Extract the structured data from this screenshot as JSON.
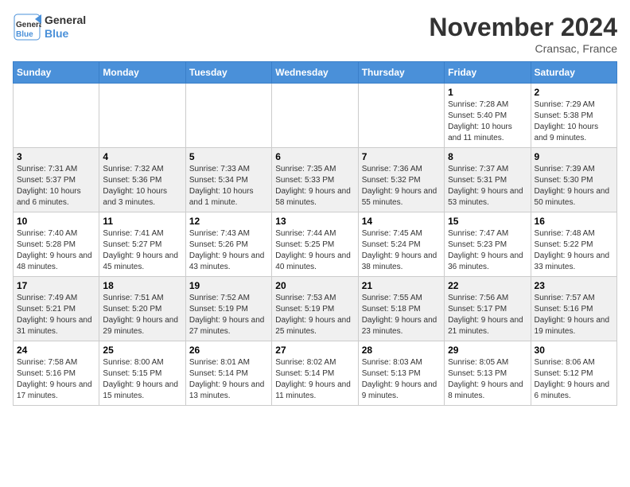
{
  "header": {
    "logo_line1": "General",
    "logo_line2": "Blue",
    "month_title": "November 2024",
    "location": "Cransac, France"
  },
  "days_of_week": [
    "Sunday",
    "Monday",
    "Tuesday",
    "Wednesday",
    "Thursday",
    "Friday",
    "Saturday"
  ],
  "weeks": [
    [
      {
        "day": "",
        "info": ""
      },
      {
        "day": "",
        "info": ""
      },
      {
        "day": "",
        "info": ""
      },
      {
        "day": "",
        "info": ""
      },
      {
        "day": "",
        "info": ""
      },
      {
        "day": "1",
        "info": "Sunrise: 7:28 AM\nSunset: 5:40 PM\nDaylight: 10 hours and 11 minutes."
      },
      {
        "day": "2",
        "info": "Sunrise: 7:29 AM\nSunset: 5:38 PM\nDaylight: 10 hours and 9 minutes."
      }
    ],
    [
      {
        "day": "3",
        "info": "Sunrise: 7:31 AM\nSunset: 5:37 PM\nDaylight: 10 hours and 6 minutes."
      },
      {
        "day": "4",
        "info": "Sunrise: 7:32 AM\nSunset: 5:36 PM\nDaylight: 10 hours and 3 minutes."
      },
      {
        "day": "5",
        "info": "Sunrise: 7:33 AM\nSunset: 5:34 PM\nDaylight: 10 hours and 1 minute."
      },
      {
        "day": "6",
        "info": "Sunrise: 7:35 AM\nSunset: 5:33 PM\nDaylight: 9 hours and 58 minutes."
      },
      {
        "day": "7",
        "info": "Sunrise: 7:36 AM\nSunset: 5:32 PM\nDaylight: 9 hours and 55 minutes."
      },
      {
        "day": "8",
        "info": "Sunrise: 7:37 AM\nSunset: 5:31 PM\nDaylight: 9 hours and 53 minutes."
      },
      {
        "day": "9",
        "info": "Sunrise: 7:39 AM\nSunset: 5:30 PM\nDaylight: 9 hours and 50 minutes."
      }
    ],
    [
      {
        "day": "10",
        "info": "Sunrise: 7:40 AM\nSunset: 5:28 PM\nDaylight: 9 hours and 48 minutes."
      },
      {
        "day": "11",
        "info": "Sunrise: 7:41 AM\nSunset: 5:27 PM\nDaylight: 9 hours and 45 minutes."
      },
      {
        "day": "12",
        "info": "Sunrise: 7:43 AM\nSunset: 5:26 PM\nDaylight: 9 hours and 43 minutes."
      },
      {
        "day": "13",
        "info": "Sunrise: 7:44 AM\nSunset: 5:25 PM\nDaylight: 9 hours and 40 minutes."
      },
      {
        "day": "14",
        "info": "Sunrise: 7:45 AM\nSunset: 5:24 PM\nDaylight: 9 hours and 38 minutes."
      },
      {
        "day": "15",
        "info": "Sunrise: 7:47 AM\nSunset: 5:23 PM\nDaylight: 9 hours and 36 minutes."
      },
      {
        "day": "16",
        "info": "Sunrise: 7:48 AM\nSunset: 5:22 PM\nDaylight: 9 hours and 33 minutes."
      }
    ],
    [
      {
        "day": "17",
        "info": "Sunrise: 7:49 AM\nSunset: 5:21 PM\nDaylight: 9 hours and 31 minutes."
      },
      {
        "day": "18",
        "info": "Sunrise: 7:51 AM\nSunset: 5:20 PM\nDaylight: 9 hours and 29 minutes."
      },
      {
        "day": "19",
        "info": "Sunrise: 7:52 AM\nSunset: 5:19 PM\nDaylight: 9 hours and 27 minutes."
      },
      {
        "day": "20",
        "info": "Sunrise: 7:53 AM\nSunset: 5:19 PM\nDaylight: 9 hours and 25 minutes."
      },
      {
        "day": "21",
        "info": "Sunrise: 7:55 AM\nSunset: 5:18 PM\nDaylight: 9 hours and 23 minutes."
      },
      {
        "day": "22",
        "info": "Sunrise: 7:56 AM\nSunset: 5:17 PM\nDaylight: 9 hours and 21 minutes."
      },
      {
        "day": "23",
        "info": "Sunrise: 7:57 AM\nSunset: 5:16 PM\nDaylight: 9 hours and 19 minutes."
      }
    ],
    [
      {
        "day": "24",
        "info": "Sunrise: 7:58 AM\nSunset: 5:16 PM\nDaylight: 9 hours and 17 minutes."
      },
      {
        "day": "25",
        "info": "Sunrise: 8:00 AM\nSunset: 5:15 PM\nDaylight: 9 hours and 15 minutes."
      },
      {
        "day": "26",
        "info": "Sunrise: 8:01 AM\nSunset: 5:14 PM\nDaylight: 9 hours and 13 minutes."
      },
      {
        "day": "27",
        "info": "Sunrise: 8:02 AM\nSunset: 5:14 PM\nDaylight: 9 hours and 11 minutes."
      },
      {
        "day": "28",
        "info": "Sunrise: 8:03 AM\nSunset: 5:13 PM\nDaylight: 9 hours and 9 minutes."
      },
      {
        "day": "29",
        "info": "Sunrise: 8:05 AM\nSunset: 5:13 PM\nDaylight: 9 hours and 8 minutes."
      },
      {
        "day": "30",
        "info": "Sunrise: 8:06 AM\nSunset: 5:12 PM\nDaylight: 9 hours and 6 minutes."
      }
    ]
  ]
}
